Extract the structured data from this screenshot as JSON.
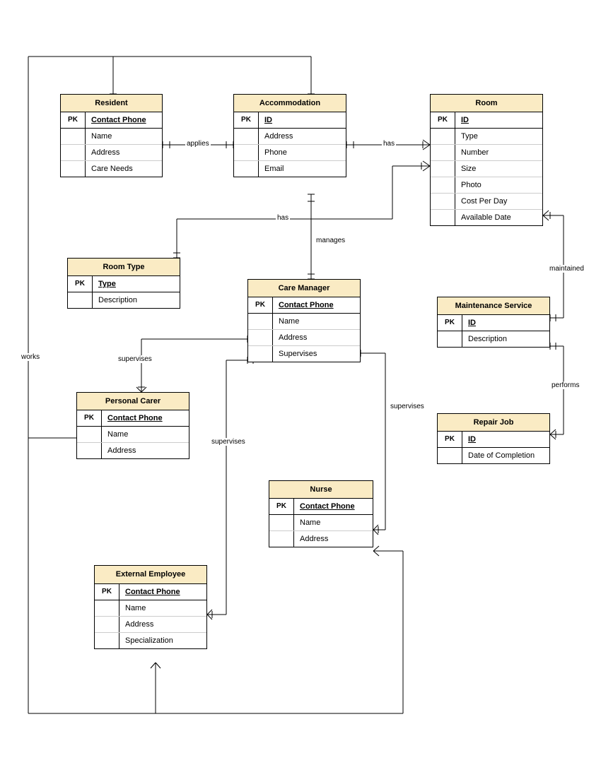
{
  "entities": {
    "resident": {
      "title": "Resident",
      "pk": "Contact Phone",
      "attrs": [
        "Name",
        "Address",
        "Care Needs"
      ]
    },
    "accommodation": {
      "title": "Accommodation",
      "pk": "ID",
      "attrs": [
        "Address",
        "Phone",
        "Email"
      ]
    },
    "room": {
      "title": "Room",
      "pk": "ID",
      "attrs": [
        "Type",
        "Number",
        "Size",
        "Photo",
        "Cost Per Day",
        "Available Date"
      ]
    },
    "roomType": {
      "title": "Room Type",
      "pk": "Type",
      "attrs": [
        "Description"
      ]
    },
    "careManager": {
      "title": "Care Manager",
      "pk": "Contact Phone",
      "attrs": [
        "Name",
        "Address",
        "Supervises"
      ]
    },
    "maintenanceService": {
      "title": "Maintenance Service",
      "pk": "ID",
      "attrs": [
        "Description"
      ]
    },
    "personalCarer": {
      "title": "Personal Carer",
      "pk": "Contact Phone",
      "attrs": [
        "Name",
        "Address"
      ]
    },
    "repairJob": {
      "title": "Repair Job",
      "pk": "ID",
      "attrs": [
        "Date of Completion"
      ]
    },
    "nurse": {
      "title": "Nurse",
      "pk": "Contact Phone",
      "attrs": [
        "Name",
        "Address"
      ]
    },
    "externalEmployee": {
      "title": "External Employee",
      "pk": "Contact Phone",
      "attrs": [
        "Name",
        "Address",
        "Specialization"
      ]
    }
  },
  "labels": {
    "applies": "applies",
    "has1": "has",
    "has2": "has",
    "manages": "manages",
    "maintained": "maintained",
    "works": "works",
    "supervises1": "supervises",
    "supervises2": "supervises",
    "supervises3": "supervises",
    "performs": "performs",
    "pkLabel": "PK"
  }
}
